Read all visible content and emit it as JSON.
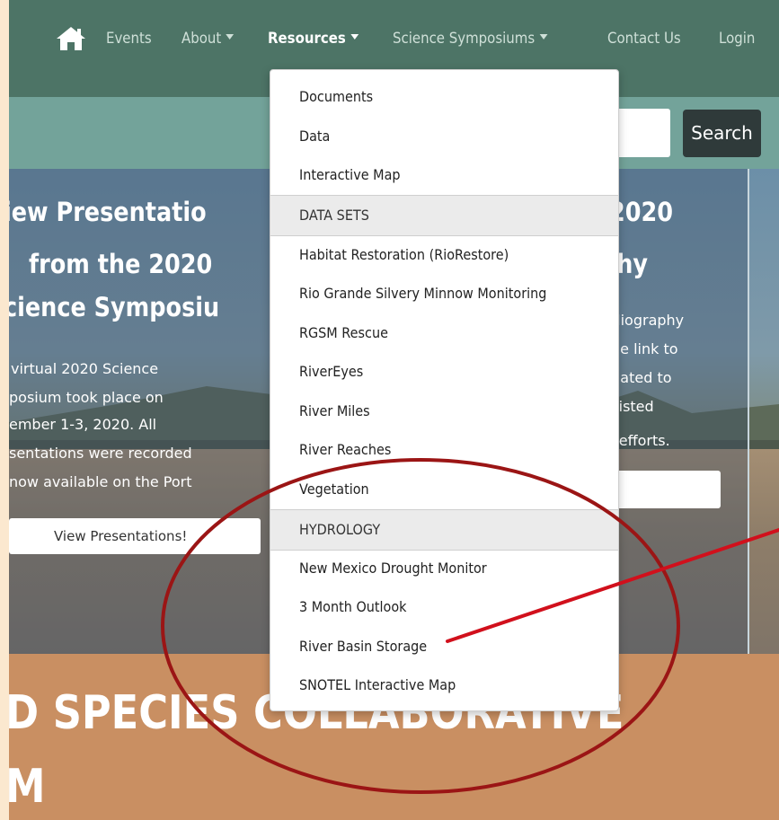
{
  "nav": {
    "items": [
      {
        "label": "Events"
      },
      {
        "label": "About"
      },
      {
        "label": "Resources"
      },
      {
        "label": "Science Symposiums"
      },
      {
        "label": "Contact Us"
      },
      {
        "label": "Login"
      }
    ]
  },
  "search": {
    "button_label": "Search",
    "value": ""
  },
  "hero": {
    "left_title": [
      "iew Presentatio",
      "from the 2020",
      "cience Symposiu"
    ],
    "left_text": [
      "virtual 2020 Science",
      "posium took place on",
      "ember 1-3, 2020. All",
      "sentations were recorded",
      "now available on the Port"
    ],
    "left_button": "View Presentations!",
    "right_title": [
      "2020",
      "phy"
    ],
    "right_text": [
      "bliography",
      "he link to",
      "elated to",
      ", listed",
      "P efforts."
    ]
  },
  "banner": {
    "lines": [
      "D SPECIES COLLABORATIVE",
      "M"
    ]
  },
  "dropdown": {
    "items_top": [
      "Documents",
      "Data",
      "Interactive Map"
    ],
    "header_datasets": "DATA SETS",
    "items_datasets": [
      "Habitat Restoration (RioRestore)",
      "Rio Grande Silvery Minnow Monitoring",
      "RGSM Rescue",
      "RiverEyes",
      "River Miles",
      "River Reaches",
      "Vegetation"
    ],
    "header_hydrology": "HYDROLOGY",
    "items_hydrology": [
      "New Mexico Drought Monitor",
      "3 Month Outlook",
      "River Basin Storage",
      "SNOTEL Interactive Map"
    ]
  },
  "colors": {
    "navbar": "#4d7466",
    "accent_annotation": "#9b1515",
    "banner": "#c98f62",
    "search_button": "#2f3a3a"
  },
  "icons": {
    "home": "home-icon",
    "caret": "caret-down-icon"
  }
}
